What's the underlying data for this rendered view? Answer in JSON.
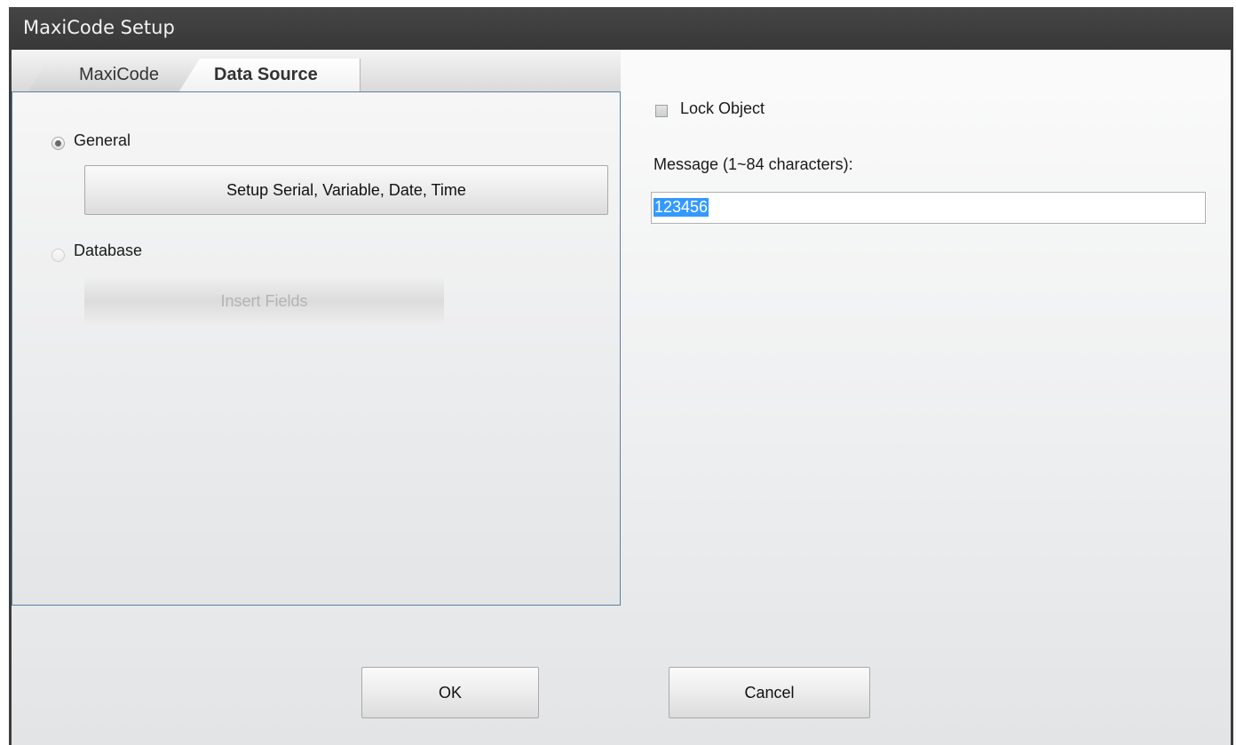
{
  "window": {
    "title": "MaxiCode Setup"
  },
  "tabs": [
    {
      "label": "MaxiCode",
      "active": false
    },
    {
      "label": "Data Source",
      "active": true
    }
  ],
  "data_source": {
    "general": {
      "label": "General",
      "selected": true
    },
    "setup_button": {
      "label": "Setup Serial, Variable, Date, Time"
    },
    "database": {
      "label": "Database",
      "selected": false,
      "enabled": false
    },
    "insert_fields_button": {
      "label": "Insert Fields",
      "enabled": false
    }
  },
  "options": {
    "lock_object": {
      "label": "Lock Object",
      "checked": false
    },
    "message_label": "Message (1~84 characters):",
    "message_value": "123456"
  },
  "footer": {
    "ok_label": "OK",
    "cancel_label": "Cancel"
  },
  "colors": {
    "titlebar": "#3d3d3d",
    "selection": "#3399ff",
    "panel_border": "#5e7fa6"
  }
}
